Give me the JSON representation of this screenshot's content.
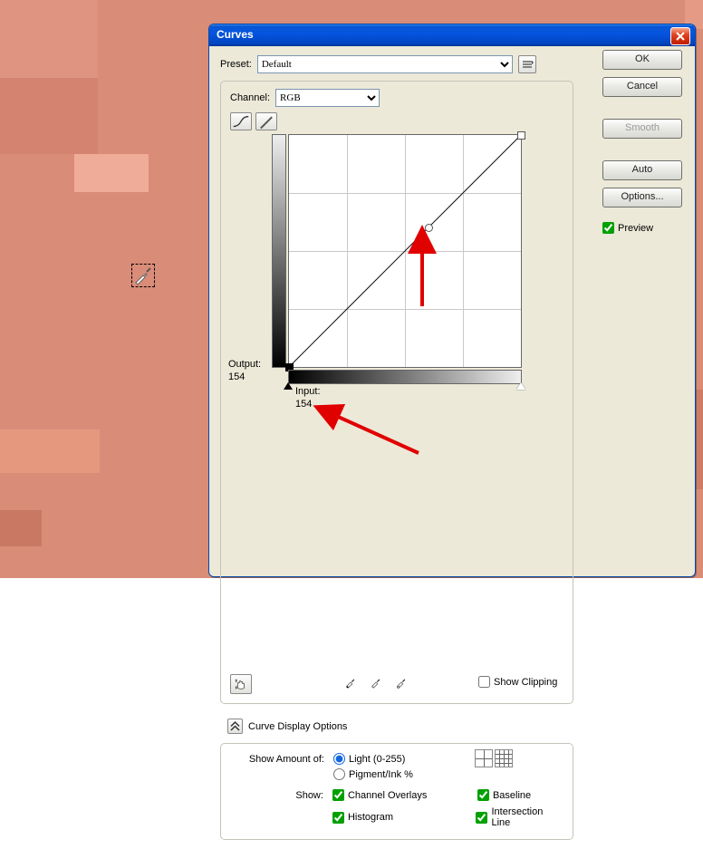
{
  "dialog": {
    "title": "Curves",
    "preset": {
      "label": "Preset:",
      "value": "Default"
    },
    "channel": {
      "label": "Channel:",
      "value": "RGB"
    },
    "output": {
      "label": "Output:",
      "value": "154"
    },
    "input": {
      "label": "Input:",
      "value": "154"
    },
    "showClipping": "Show Clipping",
    "curveDisplayOptions": "Curve Display Options",
    "showAmountOf": "Show Amount of:",
    "radio": {
      "light": "Light  (0-255)",
      "pigment": "Pigment/Ink %"
    },
    "show": "Show:",
    "checks": {
      "channelOverlays": "Channel Overlays",
      "baseline": "Baseline",
      "histogram": "Histogram",
      "intersection": "Intersection Line"
    },
    "buttons": {
      "ok": "OK",
      "cancel": "Cancel",
      "smooth": "Smooth",
      "auto": "Auto",
      "options": "Options..."
    },
    "previewLabel": "Preview"
  },
  "chart_data": {
    "type": "line",
    "title": "Curves",
    "xlabel": "Input",
    "ylabel": "Output",
    "xlim": [
      0,
      255
    ],
    "ylim": [
      0,
      255
    ],
    "series": [
      {
        "name": "RGB",
        "x": [
          0,
          154,
          255
        ],
        "y": [
          0,
          154,
          255
        ]
      }
    ],
    "point": {
      "input": 154,
      "output": 154
    }
  }
}
